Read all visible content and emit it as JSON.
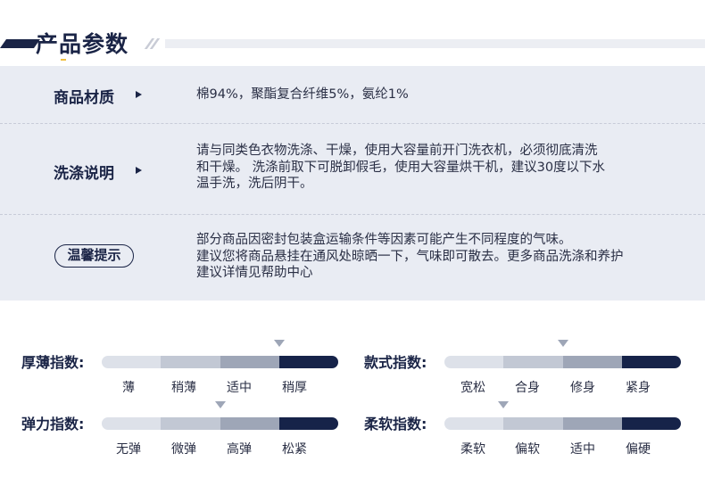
{
  "header": {
    "title": "产品参数"
  },
  "params": {
    "material": {
      "label": "商品材质",
      "value": "棉94%，聚酯复合纤维5%，氨纶1%"
    },
    "washing": {
      "label": "洗涤说明",
      "lines": [
        "请与同类色衣物洗涤、干燥，使用大容量前开门洗衣机，必须彻底清洗",
        "和干燥。 洗涤前取下可脱卸假毛，使用大容量烘干机，建议30度以下水",
        "温手洗，洗后阴干。"
      ]
    },
    "tips": {
      "label": "温馨提示",
      "lines": [
        "部分商品因密封包装盒运输条件等因素可能产生不同程度的气味。",
        "建议您将商品悬挂在通风处晾晒一下，气味即可散去。更多商品洗涤和养护",
        "建议详情见帮助中心"
      ]
    }
  },
  "indices": [
    {
      "label": "厚薄指数:",
      "options": [
        "薄",
        "稍薄",
        "适中",
        "稍厚"
      ],
      "selected_index": 2
    },
    {
      "label": "款式指数:",
      "options": [
        "宽松",
        "合身",
        "修身",
        "紧身"
      ],
      "selected_index": 1
    },
    {
      "label": "弹力指数:",
      "options": [
        "无弹",
        "微弹",
        "高弹",
        "松紧"
      ],
      "selected_index": 1
    },
    {
      "label": "柔软指数:",
      "options": [
        "柔软",
        "偏软",
        "适中",
        "偏硬"
      ],
      "selected_index": 0
    }
  ],
  "colors": {
    "primary": "#1a2446",
    "panel": "#e9ecf3",
    "marker": "#9ea6b7"
  }
}
